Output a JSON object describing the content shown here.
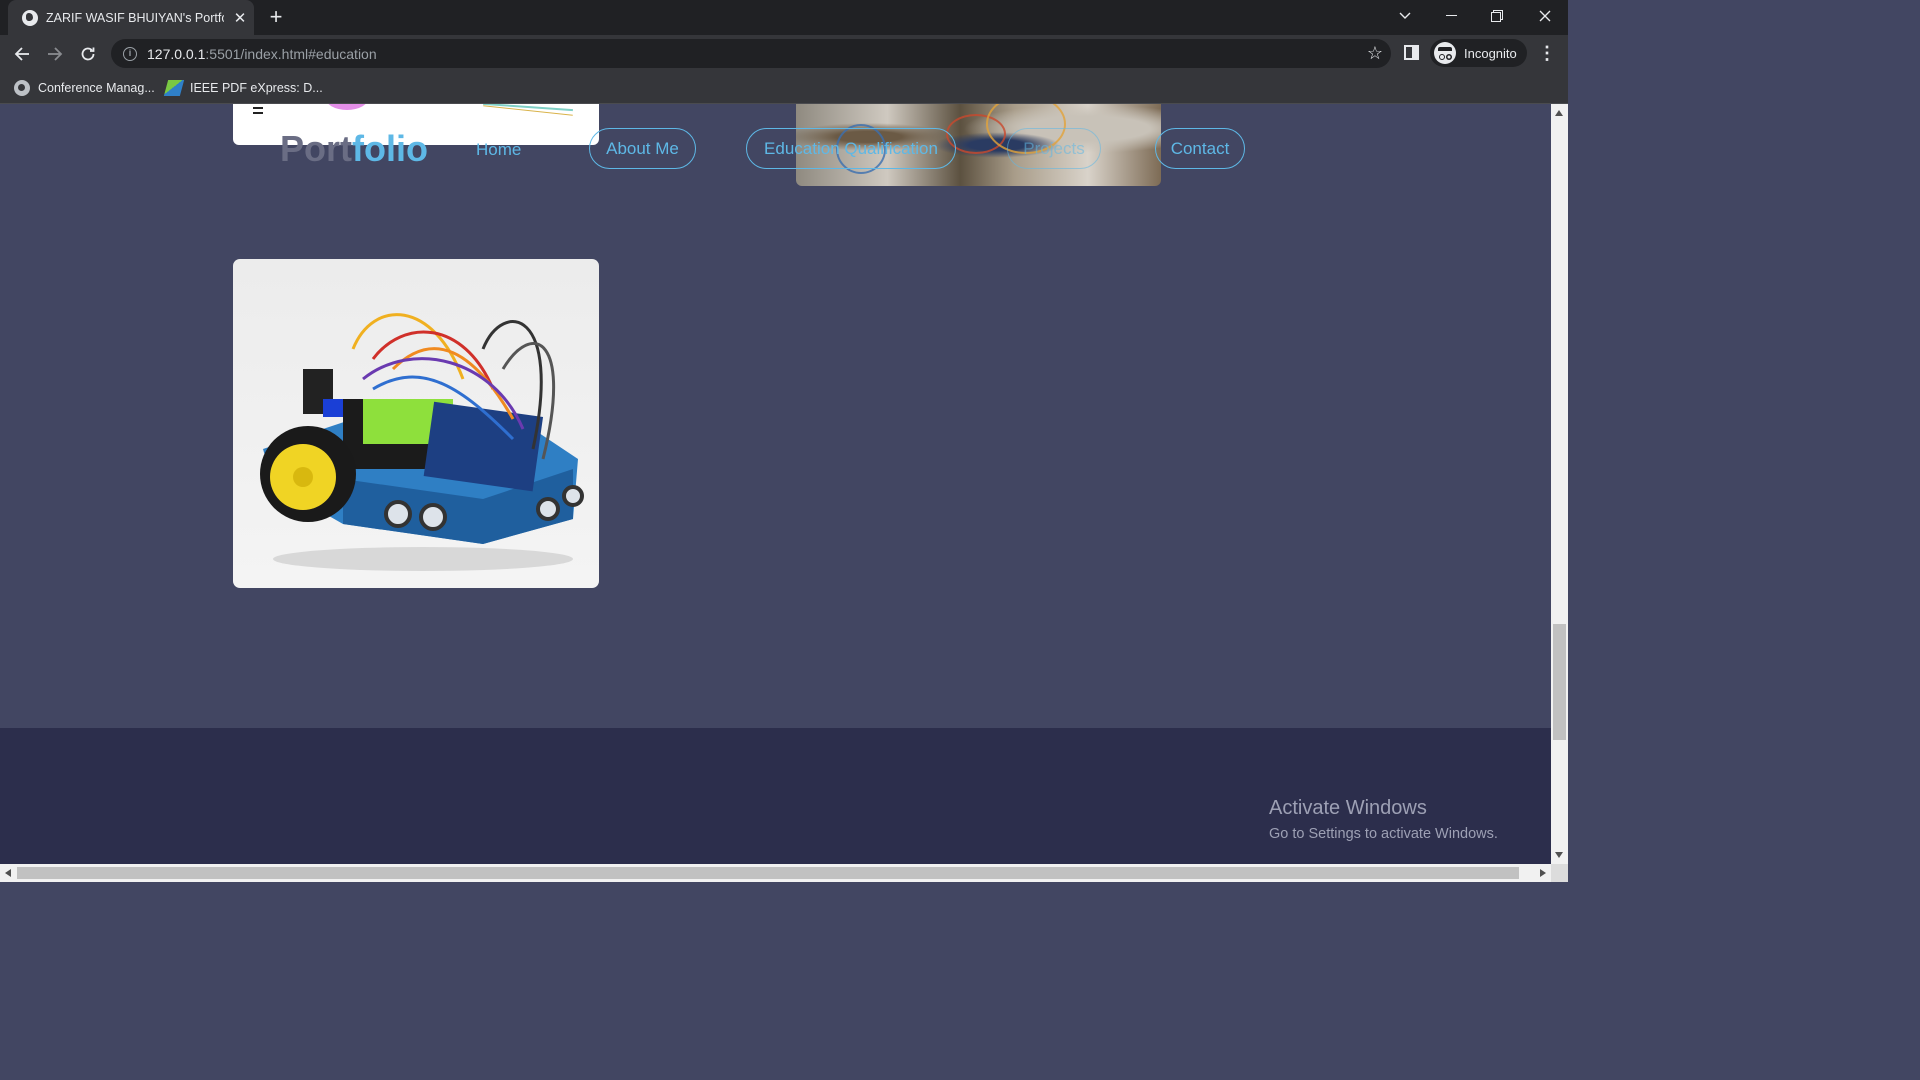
{
  "browser": {
    "tab_title": "ZARIF WASIF BHUIYAN's Portfolio",
    "new_tab_symbol": "+",
    "url_host": "127.0.0.1",
    "url_rest": ":5501/index.html#education",
    "profile_label": "Incognito",
    "bookmarks": [
      {
        "label": "Conference Manag...",
        "icon": "globe-icon"
      },
      {
        "label": "IEEE PDF eXpress: D...",
        "icon": "ieee-icon"
      }
    ]
  },
  "page": {
    "logo_part1": "Port",
    "logo_part2": "folio",
    "nav": {
      "home": "Home",
      "about": "About Me",
      "education": "Education Qualification",
      "projects": "Projects",
      "contact": "Contact"
    },
    "accent_color": "#5eb8e6",
    "background_color": "#424662",
    "footer_color": "#2c2e4c"
  },
  "os_watermark": {
    "title": "Activate Windows",
    "subtitle": "Go to Settings to activate Windows."
  }
}
